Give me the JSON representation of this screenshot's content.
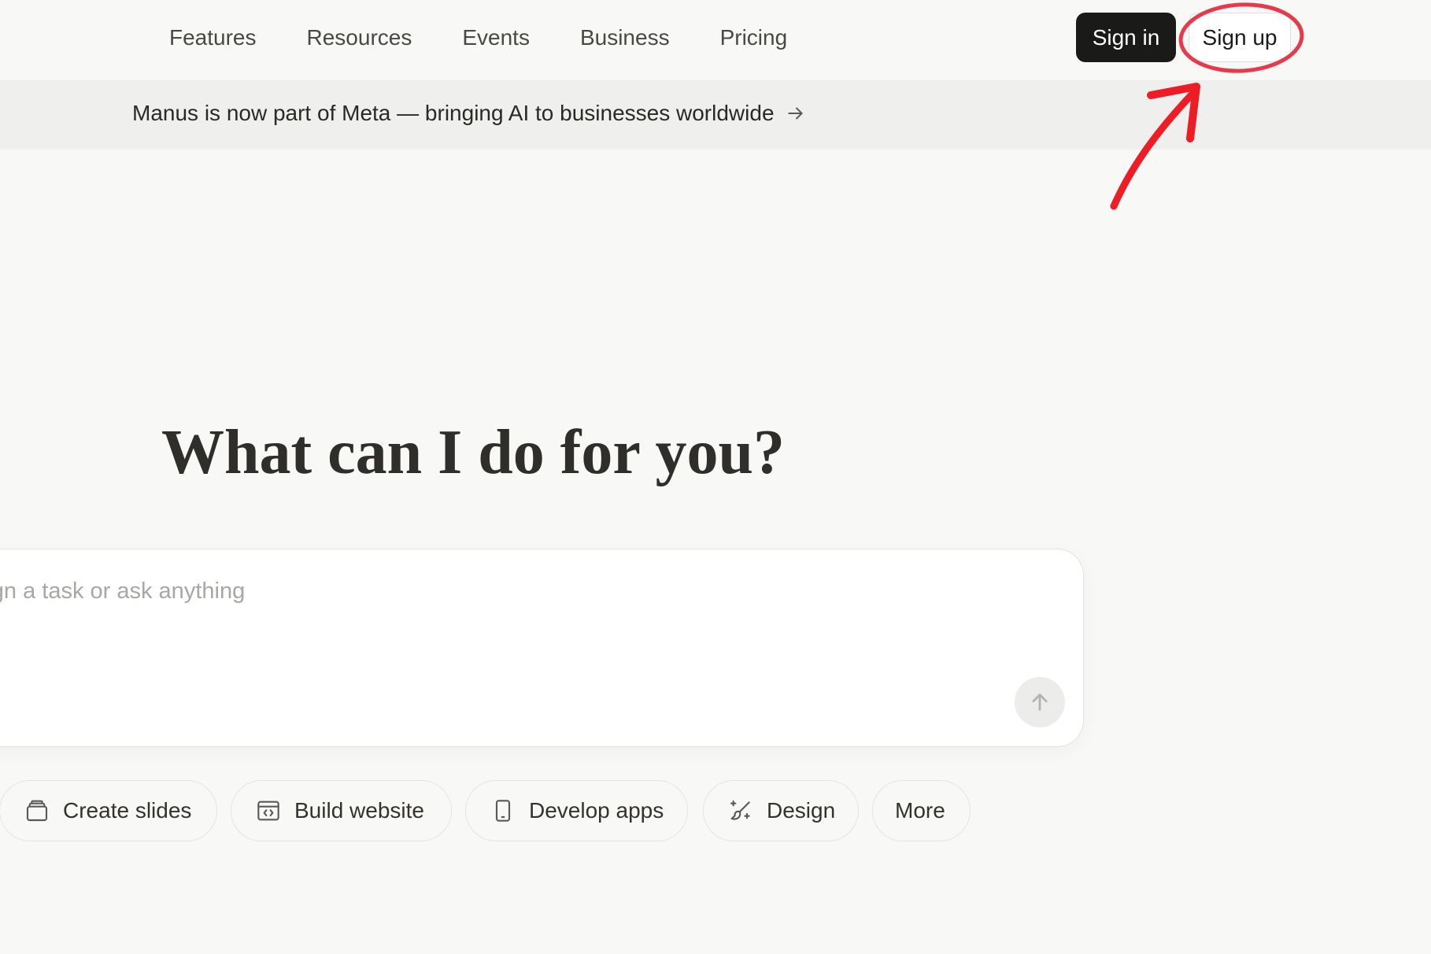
{
  "nav": {
    "links": [
      "Features",
      "Resources",
      "Events",
      "Business",
      "Pricing"
    ],
    "sign_in": "Sign in",
    "sign_up": "Sign up"
  },
  "banner": {
    "text": "Manus is now part of Meta — bringing AI to businesses worldwide",
    "icon": "arrow-right-icon"
  },
  "hero": {
    "title": "What can I do for you?"
  },
  "composer": {
    "placeholder": "Assign a task or ask anything",
    "send_icon": "arrow-up-icon"
  },
  "actions": [
    {
      "label": "Create slides",
      "icon": "slides-icon"
    },
    {
      "label": "Build website",
      "icon": "website-code-icon"
    },
    {
      "label": "Develop apps",
      "icon": "phone-icon"
    },
    {
      "label": "Design",
      "icon": "design-brush-icon"
    },
    {
      "label": "More",
      "icon": ""
    }
  ],
  "colors": {
    "background": "#f8f8f7",
    "banner": "#efefed",
    "primary_button": "#1a1a19",
    "annotation": "#ee1c25"
  }
}
